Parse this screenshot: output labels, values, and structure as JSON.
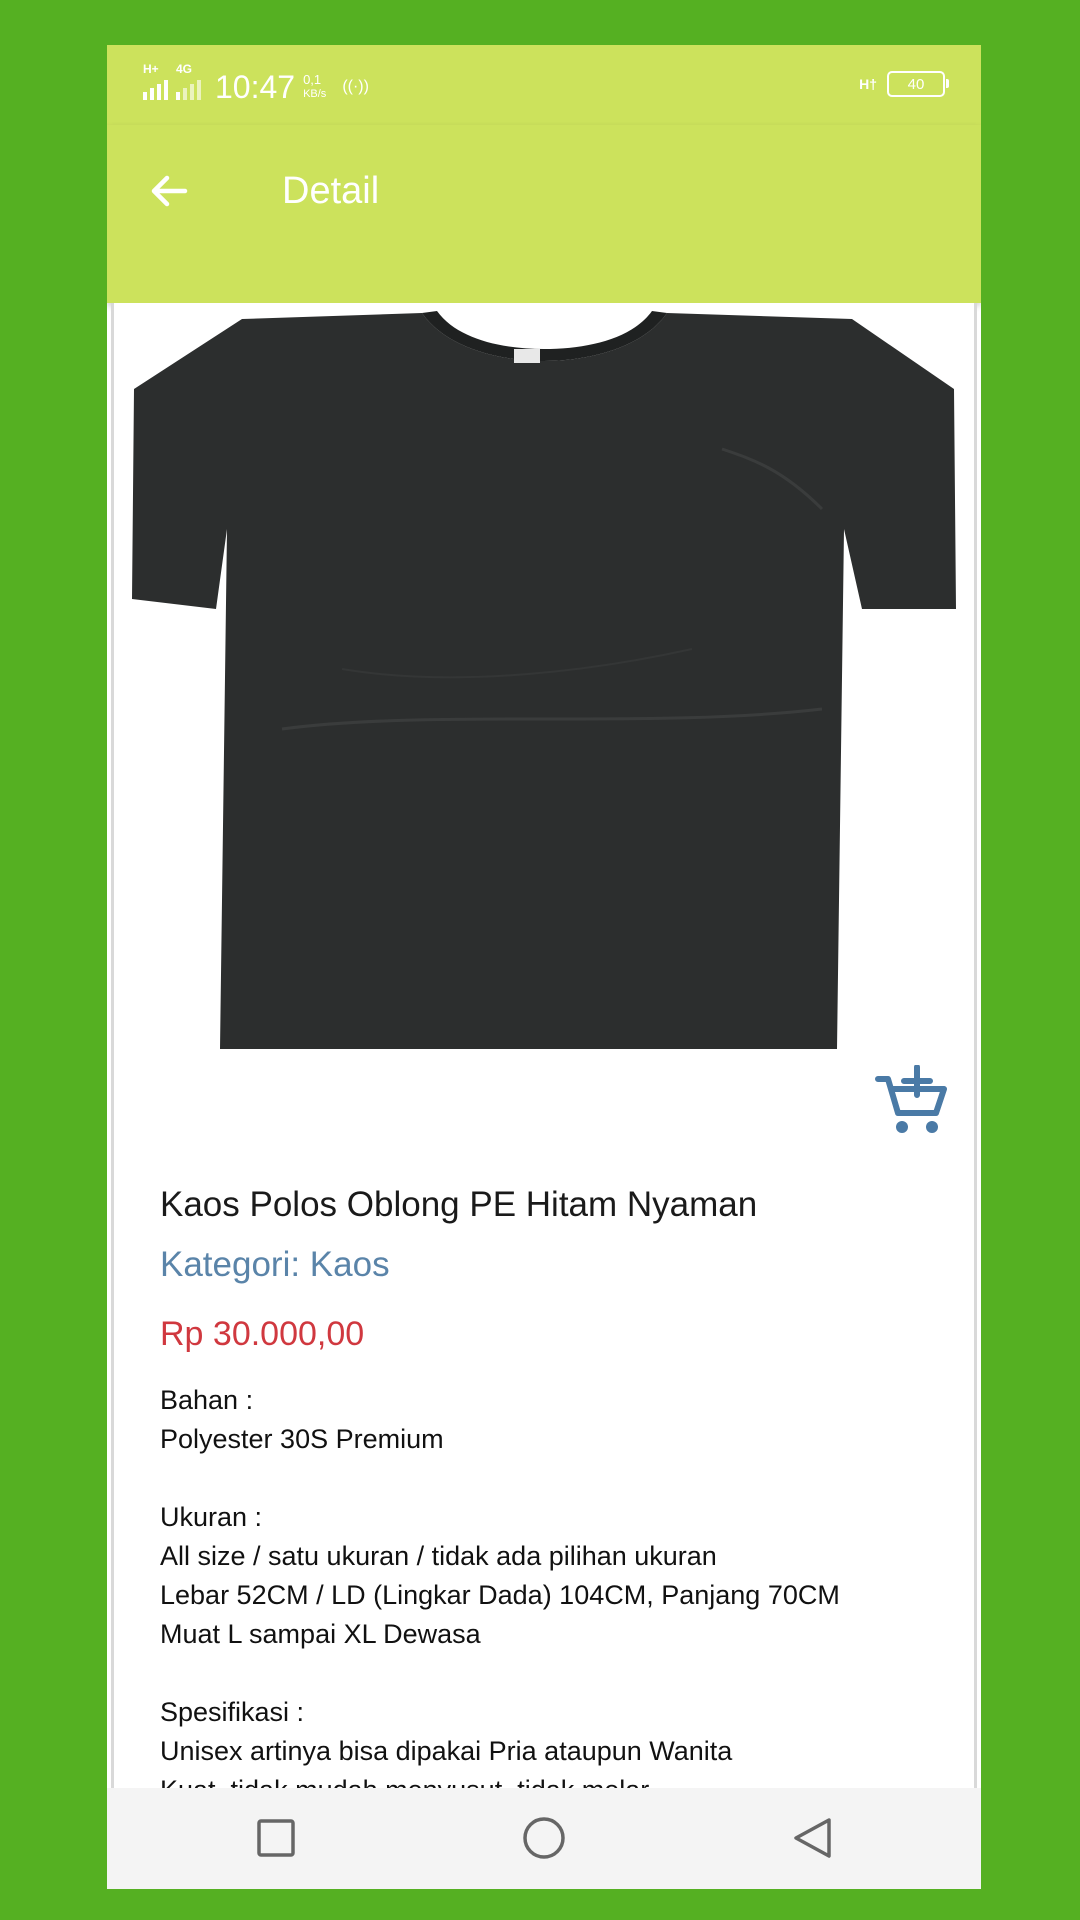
{
  "status_bar": {
    "network_left": "H+",
    "network_right": "4G",
    "time": "10:47",
    "speed_value": "0,1",
    "speed_unit": "KB/s",
    "right_network": "H†",
    "battery": "40"
  },
  "app_bar": {
    "title": "Detail",
    "back_icon": "arrow-left-icon"
  },
  "product": {
    "image_icon": "black-tshirt-image",
    "name": "Kaos Polos Oblong PE Hitam Nyaman",
    "category": "Kategori: Kaos",
    "price": "Rp 30.000,00",
    "description": "Bahan :\nPolyester 30S Premium\n\nUkuran :\nAll size / satu ukuran / tidak ada pilihan ukuran\nLebar 52CM / LD (Lingkar Dada) 104CM, Panjang 70CM\nMuat L sampai XL Dewasa\n\nSpesifikasi :\nUnisex artinya bisa dipakai Pria ataupun Wanita\nKuat, tidak mudah menyusut, tidak melar\nTidak mudah kusut"
  },
  "colors": {
    "outer_background": "#55b022",
    "app_bar": "#cce25c",
    "category_text": "#5a84a9",
    "price_text": "#d0383f",
    "cart_icon": "#4a7aa6"
  },
  "nav_bar": {
    "recents_icon": "square-icon",
    "home_icon": "circle-icon",
    "back_icon": "triangle-back-icon"
  }
}
